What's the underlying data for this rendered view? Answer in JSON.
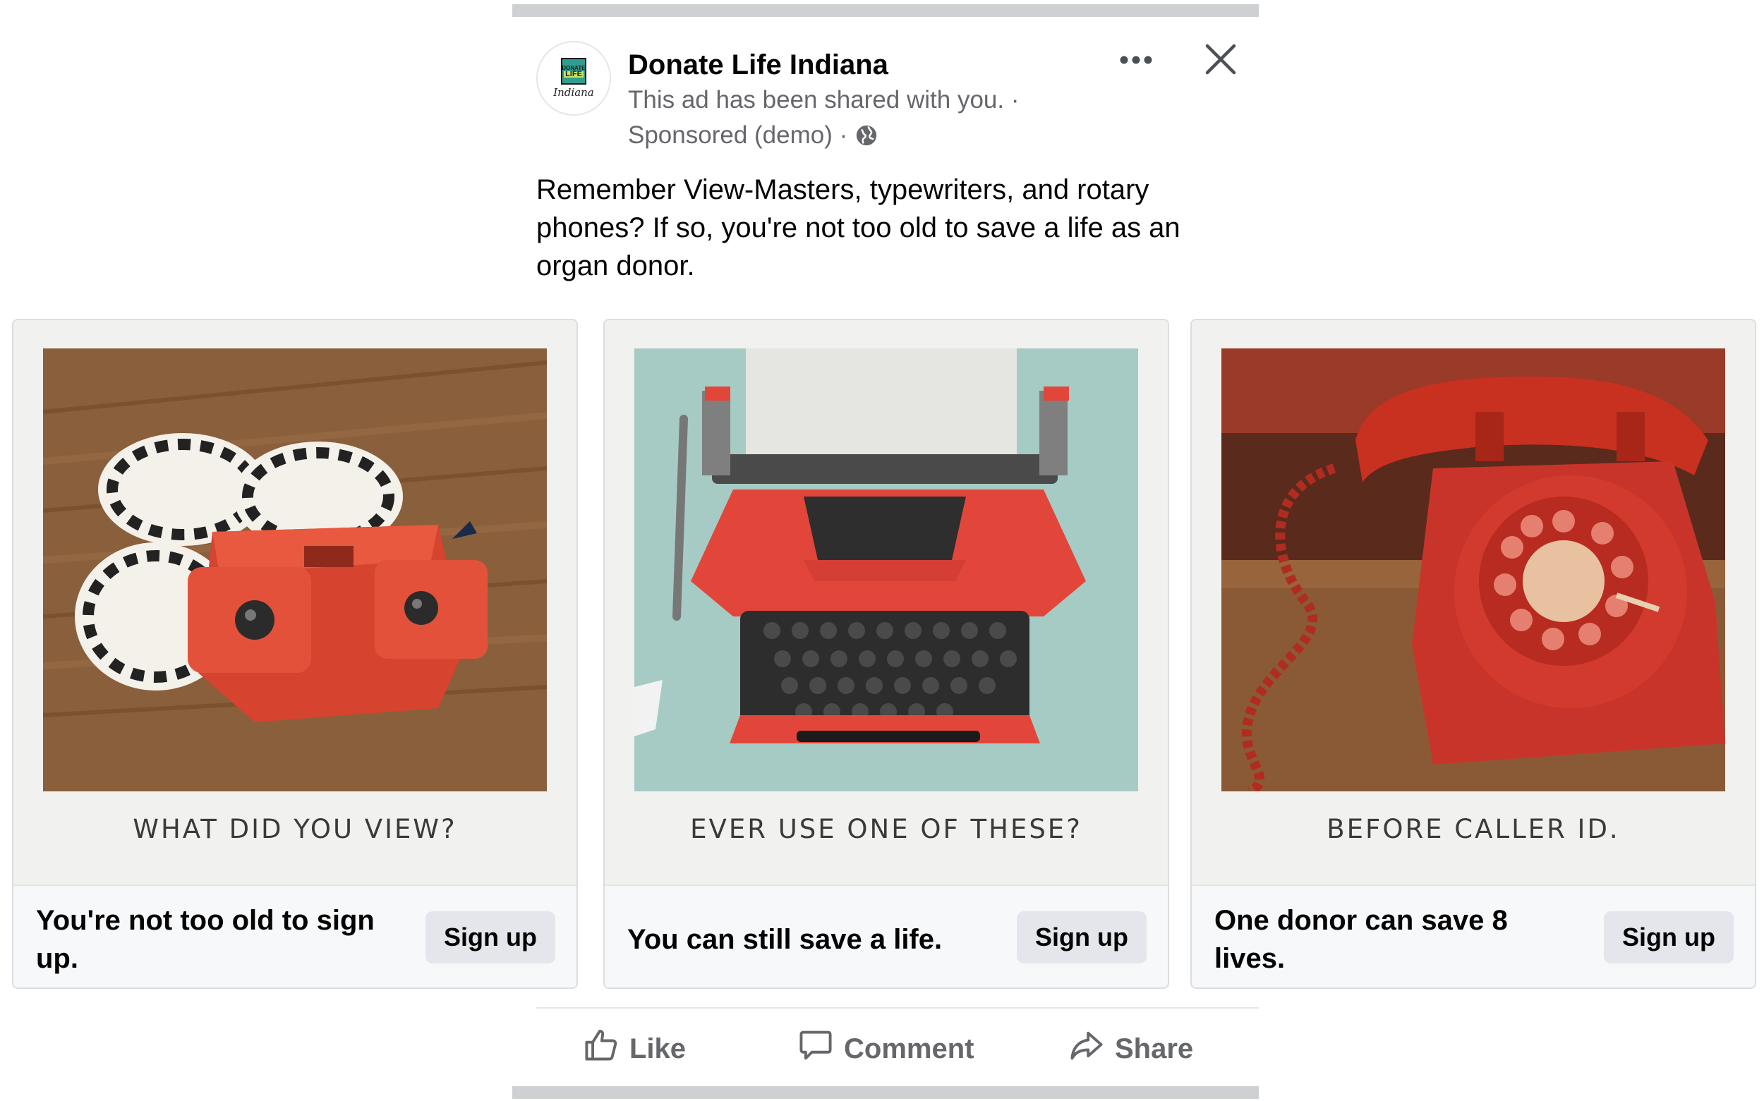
{
  "post": {
    "page_name": "Donate Life Indiana",
    "shared_note": "This ad has been shared with you. ·",
    "sponsored": "Sponsored (demo) ·",
    "message": "Remember View-Masters, typewriters, and rotary phones? If so, you're not too old to save a life as an organ donor.",
    "avatar_logo": {
      "line1": "DONATE",
      "line2": "LIFE",
      "script": "Indiana"
    },
    "privacy_icon": "globe-icon",
    "more_icon": "more-horizontal-icon",
    "close_icon": "close-icon"
  },
  "cards": [
    {
      "caption": "WHAT DID YOU VIEW?",
      "headline": "You're not too old to sign up.",
      "cta": "Sign up",
      "image": "view-master"
    },
    {
      "caption": "EVER USE ONE OF THESE?",
      "headline": "You can still save a life.",
      "cta": "Sign up",
      "image": "typewriter"
    },
    {
      "caption": "BEFORE CALLER ID.",
      "headline": "One donor can save 8 lives.",
      "cta": "Sign up",
      "image": "rotary-phone"
    }
  ],
  "actions": {
    "like": "Like",
    "comment": "Comment",
    "share": "Share"
  },
  "colors": {
    "secondary_text": "#65676b",
    "button_bg": "#e4e6eb",
    "accent_red": "#e2463a"
  }
}
